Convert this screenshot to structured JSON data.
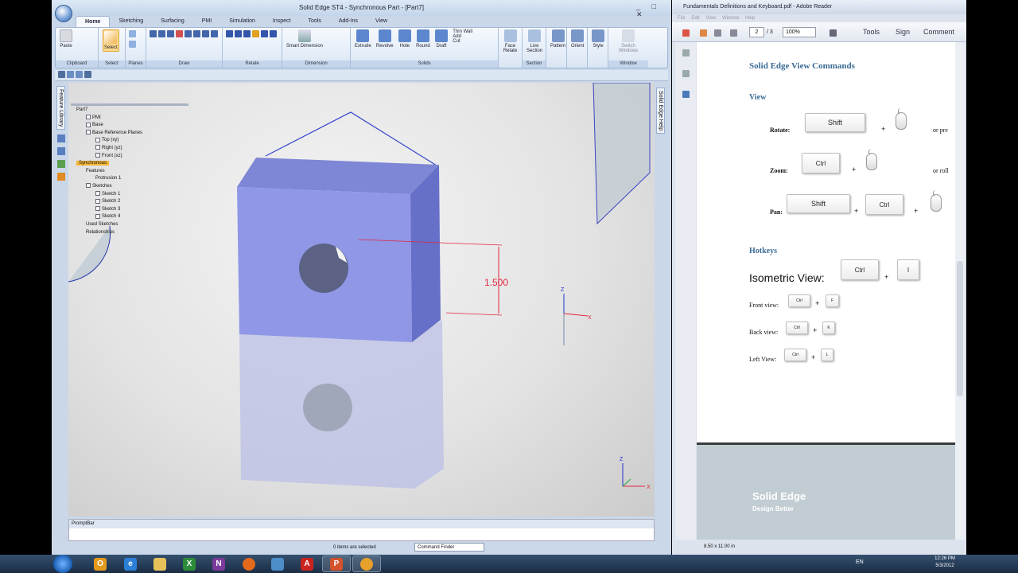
{
  "solid_edge": {
    "title": "Solid Edge ST4 - Synchronous Part - [Part7]",
    "tabs": [
      "Home",
      "Sketching",
      "Surfacing",
      "PMI",
      "Simulation",
      "Inspect",
      "Tools",
      "Add-Ins",
      "View"
    ],
    "groups": {
      "clipboard": {
        "label": "Clipboard",
        "paste": "Paste"
      },
      "select": {
        "label": "Select",
        "select": "Select"
      },
      "planes": {
        "label": "Planes"
      },
      "draw": {
        "label": "Draw"
      },
      "relate": {
        "label": "Relate"
      },
      "dimension": {
        "label": "Dimension",
        "smart_dimension": "Smart Dimension"
      },
      "solids": {
        "label": "Solids",
        "extrude": "Extrude",
        "revolve": "Revolve",
        "hole": "Hole",
        "round": "Round",
        "draft": "Draft",
        "thin_wall": "Thin Wall",
        "add": "Add",
        "cut": "Cut"
      },
      "face_relate": "Face Relate",
      "section": {
        "label": "Section",
        "live_section": "Live Section"
      },
      "pattern": "Pattern",
      "orient": "Orient",
      "style": "Style",
      "window": {
        "label": "Window",
        "switch_windows": "Switch Windows"
      }
    },
    "left_panel_tab": "Feature Library",
    "right_panel_tab": "Solid Edge Help",
    "tree": [
      {
        "label": "Part7",
        "indent": 0,
        "check": false,
        "hl": false
      },
      {
        "label": "PMI",
        "indent": 1,
        "check": true,
        "hl": false
      },
      {
        "label": "Base",
        "indent": 1,
        "check": true,
        "hl": false
      },
      {
        "label": "Base Reference Planes",
        "indent": 1,
        "check": true,
        "hl": false
      },
      {
        "label": "Top (xy)",
        "indent": 2,
        "check": true,
        "hl": false
      },
      {
        "label": "Right (yz)",
        "indent": 2,
        "check": true,
        "hl": false
      },
      {
        "label": "Front (xz)",
        "indent": 2,
        "check": true,
        "hl": false
      },
      {
        "label": "Synchronous",
        "indent": 0,
        "check": false,
        "hl": true
      },
      {
        "label": "Features",
        "indent": 1,
        "check": false,
        "hl": false
      },
      {
        "label": "Protrusion 1",
        "indent": 2,
        "check": false,
        "hl": false
      },
      {
        "label": "Sketches",
        "indent": 1,
        "check": true,
        "hl": false
      },
      {
        "label": "Sketch 1",
        "indent": 2,
        "check": true,
        "hl": false
      },
      {
        "label": "Sketch 2",
        "indent": 2,
        "check": true,
        "hl": false
      },
      {
        "label": "Sketch 3",
        "indent": 2,
        "check": true,
        "hl": false
      },
      {
        "label": "Sketch 4",
        "indent": 2,
        "check": true,
        "hl": false
      },
      {
        "label": "Used Sketches",
        "indent": 1,
        "check": false,
        "hl": false
      },
      {
        "label": "Relationships",
        "indent": 1,
        "check": false,
        "hl": false
      }
    ],
    "dimension_value": "1.500",
    "axis": {
      "z": "Z",
      "x": "X"
    },
    "promptbar": "PromptBar",
    "status_items": "0 items are selected",
    "command_finder": "Command Finder"
  },
  "reader": {
    "title": "Fundamentals Definitions and Keyboard.pdf - Adobe Reader",
    "menu": [
      "File",
      "Edit",
      "View",
      "Window",
      "Help"
    ],
    "page_current": "2",
    "page_total": "/ 3",
    "zoom": "100%",
    "tools": "Tools",
    "sign": "Sign",
    "comment": "Comment",
    "doc_title": "Solid Edge View Commands",
    "view_heading": "View",
    "rotate": "Rotate:",
    "zoom_lbl": "Zoom:",
    "pan": "Pan:",
    "or_pre": "or   pre",
    "or_roll": "or roll",
    "key_shift": "Shift",
    "key_ctrl": "Ctrl",
    "plus": "+",
    "hotkeys_heading": "Hotkeys",
    "iso_view": "Isometric View:",
    "key_i": "I",
    "front_view": "Front view:",
    "key_f": "F",
    "back_view": "Back view:",
    "key_k": "K",
    "left_view": "Left View:",
    "key_l": "L",
    "footer_brand": "Solid Edge",
    "footer_tag": "Design Better",
    "page_size": "8.50 x 11.00 in"
  },
  "taskbar": {
    "lang": "EN",
    "time": "12:26 PM",
    "date": "5/3/2012"
  }
}
